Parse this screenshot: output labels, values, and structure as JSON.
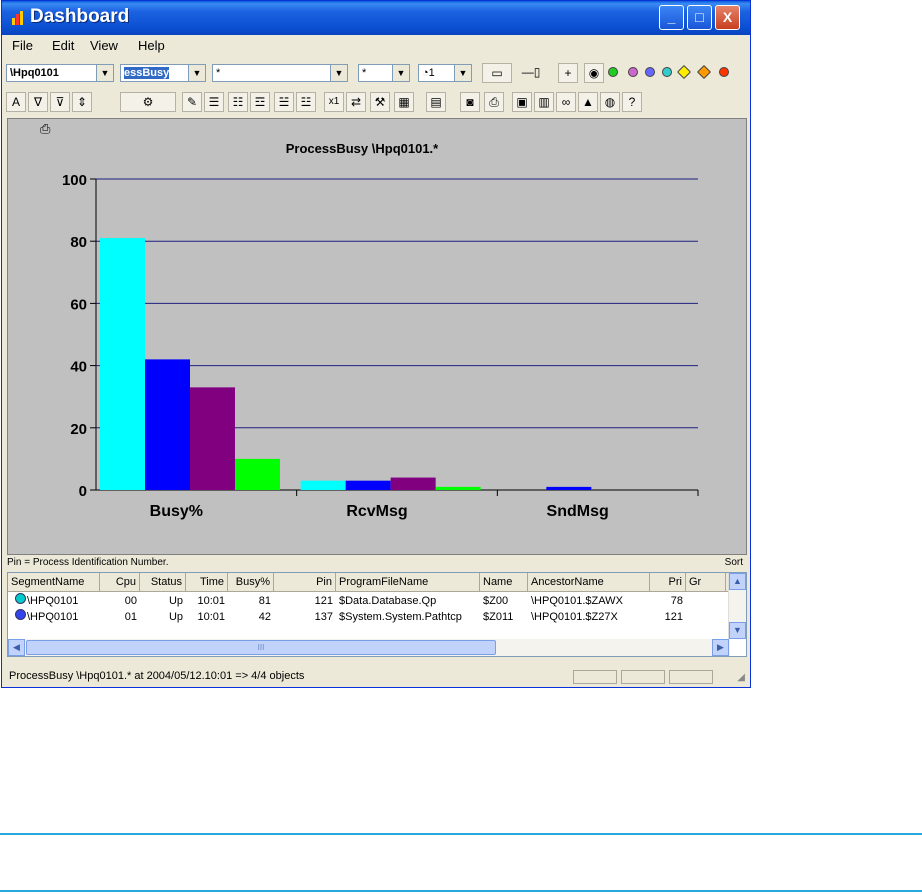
{
  "window": {
    "title": "Dashboard",
    "minimize": "_",
    "maximize": "□",
    "close": "X"
  },
  "menu": [
    {
      "label": "File"
    },
    {
      "label": "Edit"
    },
    {
      "label": "View"
    },
    {
      "label": "Help"
    }
  ],
  "toolbar1": {
    "system": "\\Hpq0101",
    "entity": "essBusy",
    "filter1": "*",
    "filter2": "*",
    "interval": "1"
  },
  "chart_data": {
    "type": "bar",
    "title": "ProcessBusy \\Hpq0101.*",
    "categories": [
      "Busy%",
      "RcvMsg",
      "SndMsg"
    ],
    "series": [
      {
        "values": [
          81,
          3,
          0
        ],
        "color": "#00ffff"
      },
      {
        "values": [
          42,
          3,
          1
        ],
        "color": "#0000ff"
      },
      {
        "values": [
          33,
          4,
          0
        ],
        "color": "#800080"
      },
      {
        "values": [
          10,
          1,
          0
        ],
        "color": "#00ff00"
      }
    ],
    "ylim": [
      0,
      100
    ],
    "yticks": [
      "0",
      "20",
      "40",
      "60",
      "80",
      "100"
    ],
    "grid": true
  },
  "pinbar": {
    "note": "Pin = Process Identification Number.",
    "sort": "Sort"
  },
  "table": {
    "columns": [
      "SegmentName",
      "Cpu",
      "Status",
      "Time",
      "Busy%",
      "Pin",
      "ProgramFileName",
      "Name",
      "AncestorName",
      "Pri",
      "Gr"
    ],
    "rows": [
      [
        "\\HPQ0101",
        "00",
        "Up",
        "10:01",
        "81",
        "121",
        "$Data.Database.Qp",
        "$Z00",
        "\\HPQ0101.$ZAWX",
        "78",
        ""
      ],
      [
        "\\HPQ0101",
        "01",
        "Up",
        "10:01",
        "42",
        "137",
        "$System.System.Pathtcp",
        "$Z011",
        "\\HPQ0101.$Z27X",
        "121",
        ""
      ]
    ],
    "scroll_mark": "III"
  },
  "status": {
    "text": "ProcessBusy \\Hpq0101.* at 2004/05/12.10:01 => 4/4 objects"
  }
}
